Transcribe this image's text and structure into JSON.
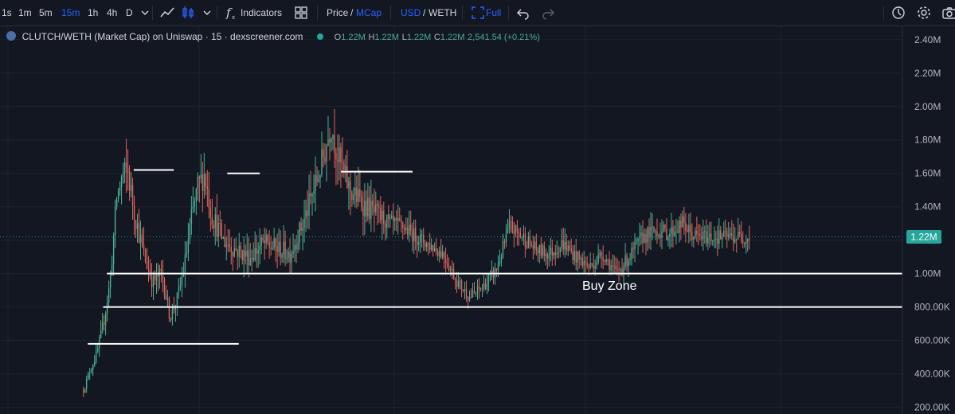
{
  "toolbar": {
    "intervals": [
      "1s",
      "1m",
      "5m",
      "15m",
      "1h",
      "4h",
      "D"
    ],
    "active_interval": "15m",
    "indicators_label": "Indicators",
    "price_label": "Price",
    "price_separator": "/",
    "mcap_label": "MCap",
    "usd_label": "USD",
    "pair_separator": "/",
    "weth_label": "WETH",
    "full_label": "Full",
    "icons": [
      "chevron-down-icon",
      "line-chart-icon",
      "candles-icon",
      "chevron-down-icon",
      "function-icon",
      "layout-icon",
      "fullscreen-icon",
      "undo-icon",
      "redo-icon",
      "clock-icon",
      "gear-icon",
      "camera-icon"
    ]
  },
  "legend": {
    "title": "CLUTCH/WETH (Market Cap) on Uniswap · 15 · dexscreener.com",
    "o_label": "O",
    "o_value": "1.22M",
    "h_label": "H",
    "h_value": "1.22M",
    "l_label": "L",
    "l_value": "1.22M",
    "c_label": "C",
    "c_value": "1.22M",
    "change": "2,541.54 (+0.21%)"
  },
  "chart_data": {
    "type": "candlestick",
    "y_axis_ticks": [
      "2.40M",
      "2.20M",
      "2.00M",
      "1.80M",
      "1.60M",
      "1.40M",
      "1.20M",
      "1.00M",
      "800.00K",
      "600.00K",
      "400.00K",
      "200.00K"
    ],
    "ylim": [
      160000,
      2480000
    ],
    "current_price_label": "1.22M",
    "current_price_value": 1220000,
    "colors": {
      "up": "#4caf93",
      "down": "#e0645c",
      "background": "#131722",
      "grid": "#1e222d",
      "price_tag": "#26a69a"
    },
    "annotation": "Buy Zone",
    "horizontal_lines": [
      {
        "y": 1000000,
        "x_start": 0.112,
        "x_end": 0.95
      },
      {
        "y": 800000,
        "x_start": 0.108,
        "x_end": 0.95
      },
      {
        "y": 580000,
        "x_start": 0.092,
        "x_end": 0.25
      },
      {
        "y": 1620000,
        "x_start": 0.14,
        "x_end": 0.182
      },
      {
        "y": 1600000,
        "x_start": 0.238,
        "x_end": 0.272
      },
      {
        "y": 1610000,
        "x_start": 0.357,
        "x_end": 0.432
      }
    ],
    "price_path_keypoints": [
      [
        0.0,
        0.3
      ],
      [
        0.008,
        0.4
      ],
      [
        0.02,
        0.52
      ],
      [
        0.03,
        0.7
      ],
      [
        0.04,
        0.95
      ],
      [
        0.05,
        1.45
      ],
      [
        0.058,
        1.58
      ],
      [
        0.066,
        1.62
      ],
      [
        0.076,
        1.38
      ],
      [
        0.09,
        1.12
      ],
      [
        0.104,
        0.95
      ],
      [
        0.118,
        1.0
      ],
      [
        0.13,
        0.74
      ],
      [
        0.142,
        0.86
      ],
      [
        0.152,
        1.05
      ],
      [
        0.162,
        1.32
      ],
      [
        0.172,
        1.52
      ],
      [
        0.182,
        1.6
      ],
      [
        0.192,
        1.36
      ],
      [
        0.21,
        1.2
      ],
      [
        0.23,
        1.14
      ],
      [
        0.25,
        1.1
      ],
      [
        0.27,
        1.18
      ],
      [
        0.29,
        1.15
      ],
      [
        0.31,
        1.12
      ],
      [
        0.33,
        1.3
      ],
      [
        0.35,
        1.55
      ],
      [
        0.362,
        1.72
      ],
      [
        0.372,
        1.9
      ],
      [
        0.382,
        1.7
      ],
      [
        0.4,
        1.5
      ],
      [
        0.42,
        1.42
      ],
      [
        0.44,
        1.35
      ],
      [
        0.46,
        1.3
      ],
      [
        0.48,
        1.28
      ],
      [
        0.5,
        1.22
      ],
      [
        0.52,
        1.17
      ],
      [
        0.54,
        1.12
      ],
      [
        0.56,
        0.96
      ],
      [
        0.58,
        0.86
      ],
      [
        0.6,
        0.92
      ],
      [
        0.62,
        1.02
      ],
      [
        0.64,
        1.28
      ],
      [
        0.66,
        1.22
      ],
      [
        0.68,
        1.14
      ],
      [
        0.7,
        1.12
      ],
      [
        0.72,
        1.18
      ],
      [
        0.74,
        1.1
      ],
      [
        0.76,
        1.04
      ],
      [
        0.78,
        1.12
      ],
      [
        0.8,
        1.0
      ],
      [
        0.82,
        1.1
      ],
      [
        0.84,
        1.22
      ],
      [
        0.86,
        1.26
      ],
      [
        0.88,
        1.24
      ],
      [
        0.9,
        1.3
      ],
      [
        0.912,
        1.24
      ],
      [
        0.921,
        1.22
      ]
    ]
  }
}
